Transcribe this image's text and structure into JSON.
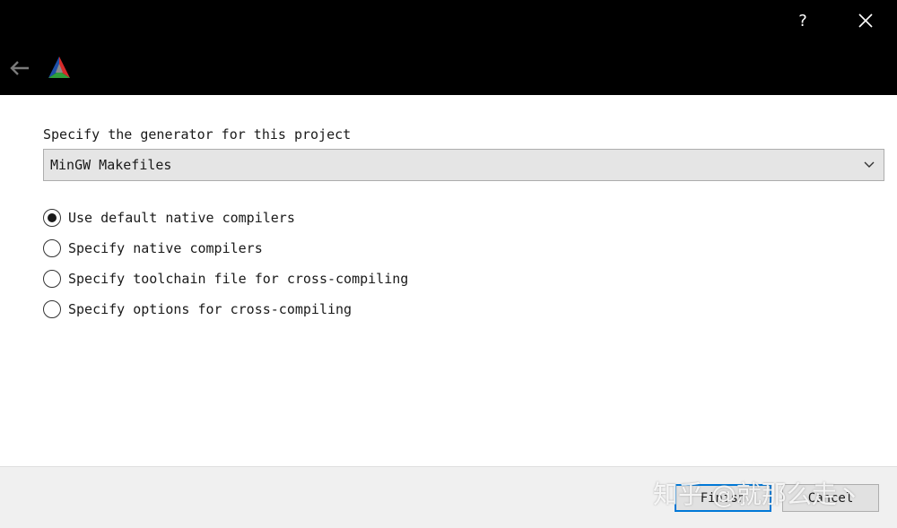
{
  "titlebar": {
    "help_label": "?",
    "help_icon": "question-mark-icon",
    "close_icon": "close-icon",
    "back_icon": "back-arrow-icon",
    "logo_icon": "cmake-logo-icon"
  },
  "main": {
    "prompt": "Specify the generator for this project",
    "generator": {
      "selected": "MinGW Makefiles"
    },
    "options": [
      {
        "label": "Use default native compilers",
        "checked": true
      },
      {
        "label": "Specify native compilers",
        "checked": false
      },
      {
        "label": "Specify toolchain file for cross-compiling",
        "checked": false
      },
      {
        "label": "Specify options for cross-compiling",
        "checked": false
      }
    ]
  },
  "footer": {
    "finish_label": "Finish",
    "cancel_label": "Cancel"
  },
  "watermark": "知乎 @就那么走丶",
  "colors": {
    "titlebar_bg": "#000000",
    "content_bg": "#ffffff",
    "footer_bg": "#f0f0f0",
    "focus_border": "#0078d7"
  }
}
